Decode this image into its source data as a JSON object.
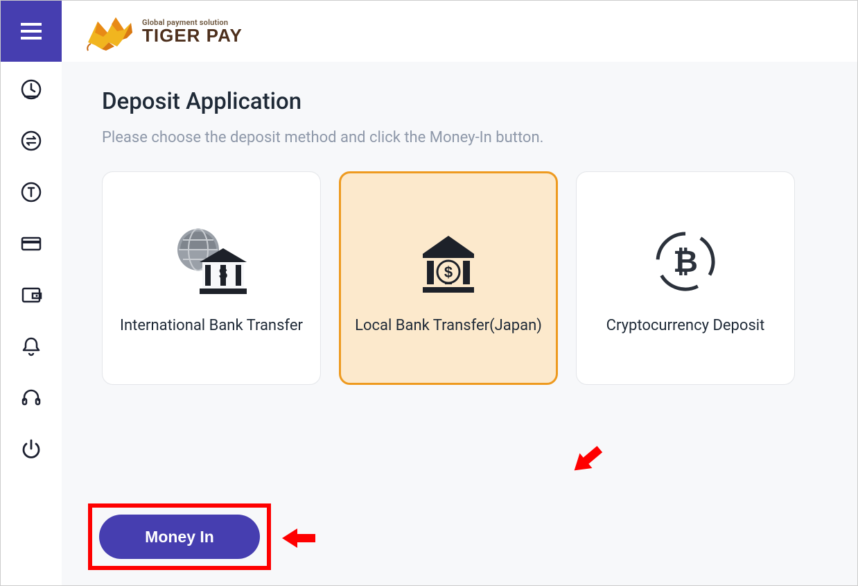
{
  "brand": {
    "tagline": "Global payment solution",
    "name": "TIGER PAY"
  },
  "sidebar": {
    "items": [
      {
        "icon": "clock"
      },
      {
        "icon": "swap"
      },
      {
        "icon": "target"
      },
      {
        "icon": "card"
      },
      {
        "icon": "wallet"
      },
      {
        "icon": "bell"
      },
      {
        "icon": "headset"
      },
      {
        "icon": "power"
      }
    ]
  },
  "page": {
    "title": "Deposit Application",
    "subtitle": "Please choose the deposit method and click the Money-In button."
  },
  "deposit": {
    "options": [
      {
        "label": "International Bank Transfer",
        "icon": "intl-bank",
        "selected": false
      },
      {
        "label": "Local Bank Transfer(Japan)",
        "icon": "bank",
        "selected": true
      },
      {
        "label": "Cryptocurrency Deposit",
        "icon": "crypto",
        "selected": false
      }
    ],
    "action_label": "Money In"
  },
  "annotations": {
    "arrow_card": true,
    "arrow_button": true
  }
}
